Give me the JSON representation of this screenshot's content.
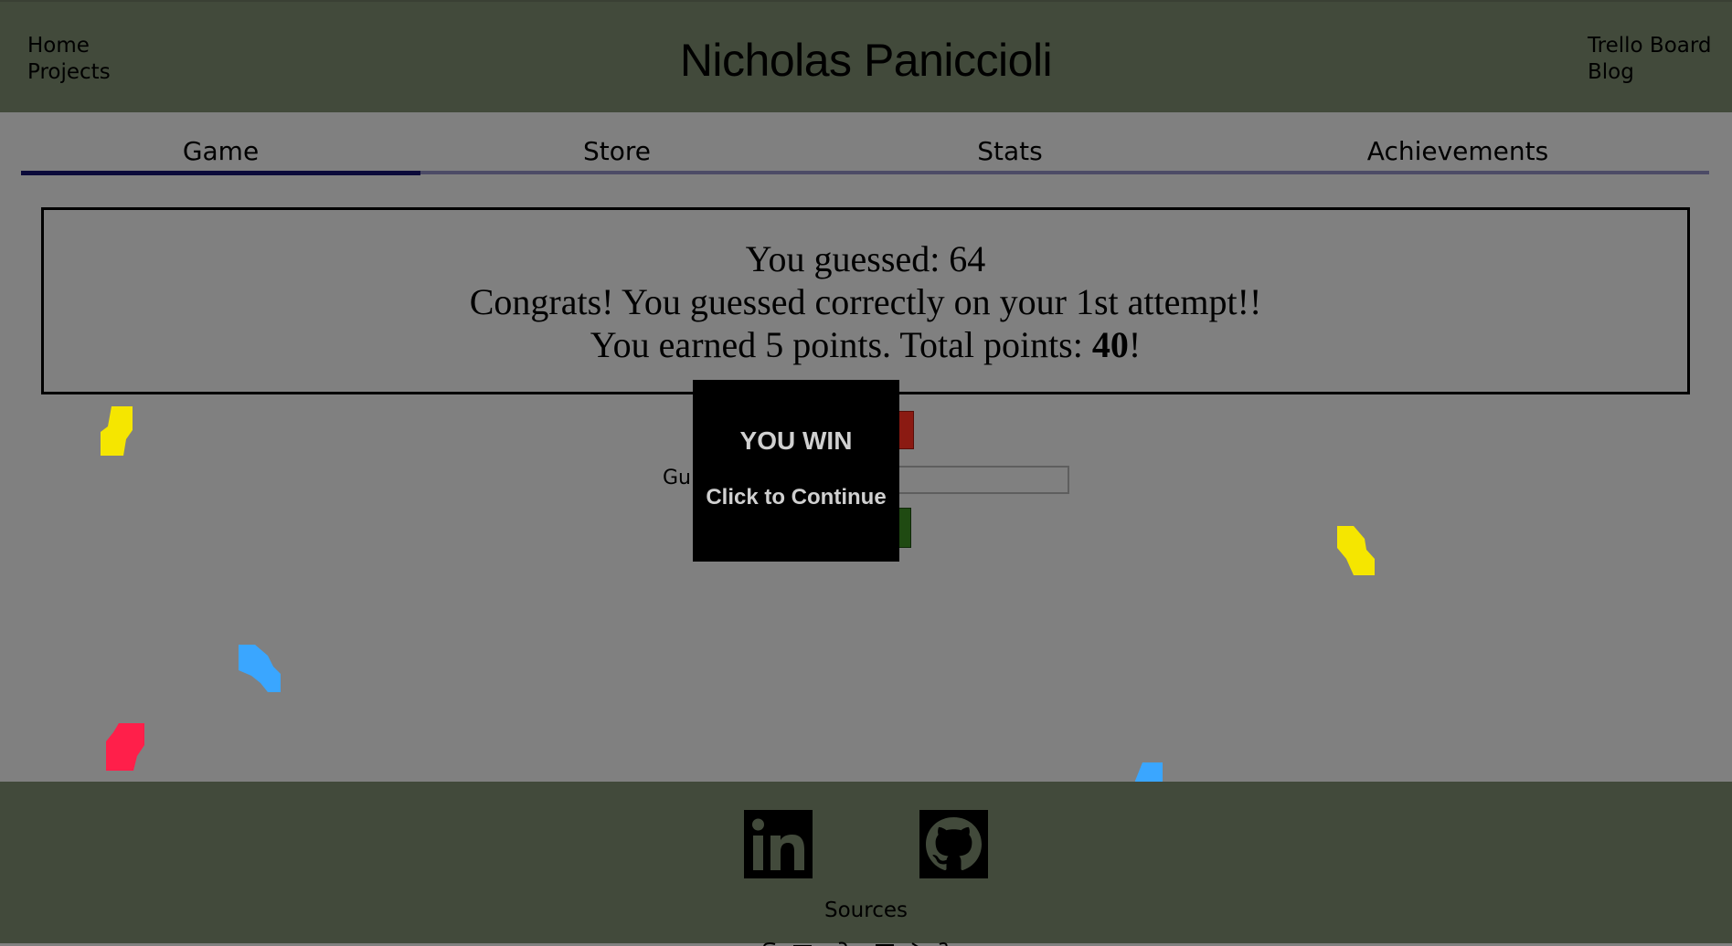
{
  "header": {
    "title": "Nicholas Paniccioli",
    "left_links": [
      "Home",
      "Projects"
    ],
    "right_links": [
      "Trello Board",
      "Blog"
    ]
  },
  "tabs": [
    {
      "label": "Game",
      "active": true
    },
    {
      "label": "Store",
      "active": false
    },
    {
      "label": "Stats",
      "active": false
    },
    {
      "label": "Achievements",
      "active": false
    }
  ],
  "result": {
    "line1": "You guessed: 64",
    "line2": "Congrats! You guessed correctly on your 1st attempt!!",
    "line3_prefix": "You earned 5 points. Total points: ",
    "line3_total": "40",
    "line3_suffix": "!"
  },
  "form": {
    "guess_label_visible": "Gu"
  },
  "modal": {
    "title": "YOU WIN",
    "subtitle": "Click to Continue"
  },
  "footer": {
    "icons": [
      "linkedin-icon",
      "github-icon"
    ],
    "sources_label": "Sources"
  },
  "colors": {
    "header_bg": "#424a3b",
    "page_bg": "#808080",
    "tab_active": "#0b0a3a",
    "tab_inactive": "#4c4b66",
    "confetti_yellow": "#f5e600",
    "confetti_blue": "#3aa6ff",
    "confetti_red": "#ff1f4a"
  }
}
